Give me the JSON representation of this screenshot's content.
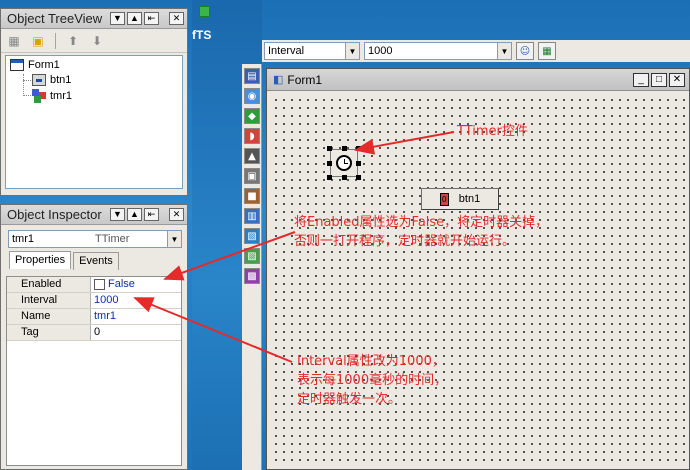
{
  "desktop": {
    "partial_text": "fTS"
  },
  "tree_view": {
    "title": "Object TreeView",
    "nodes": [
      {
        "label": "Form1",
        "icon": "form-icon"
      },
      {
        "label": "btn1",
        "icon": "button-icon"
      },
      {
        "label": "tmr1",
        "icon": "timer-component-icon"
      }
    ]
  },
  "inspector": {
    "title": "Object Inspector",
    "selected_name": "tmr1",
    "selected_type": "TTimer",
    "tabs": [
      "Properties",
      "Events"
    ],
    "properties": [
      {
        "name": "Enabled",
        "value": "False",
        "checkbox": true
      },
      {
        "name": "Interval",
        "value": "1000"
      },
      {
        "name": "Name",
        "value": "tmr1"
      },
      {
        "name": "Tag",
        "value": "0"
      }
    ]
  },
  "ide_toolbar": {
    "property_combo": "Interval",
    "value_combo": "1000"
  },
  "form": {
    "title": "Form1",
    "button_label": "btn1",
    "button_glyph": "0"
  },
  "annotations": {
    "timer": "TTimer控件",
    "enabled_line1": "将Enabled属性选为False，将定时器关掉，",
    "enabled_line2": "否则一打开程序，定时器就开始运行。",
    "interval_line1": "Interval属性改为1000，",
    "interval_line2": "表示每1000毫秒的时间，",
    "interval_line3": "定时器触发一次。"
  },
  "colors": {
    "annotation": "#e32b2b",
    "desktop": "#1e73b8",
    "value_text": "#0b2ea8"
  }
}
